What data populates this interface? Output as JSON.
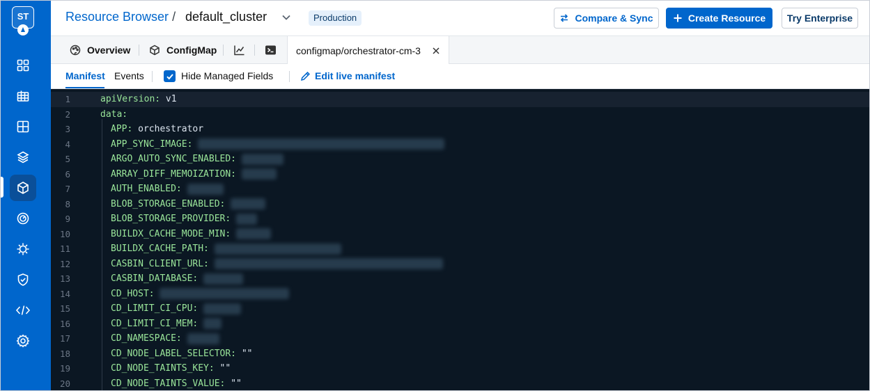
{
  "sidebar": {
    "logo_text": "ST",
    "items": [
      {
        "icon": "dashboard-grid-icon",
        "active": false
      },
      {
        "icon": "table-grid-icon",
        "active": false
      },
      {
        "icon": "apps-grid-icon",
        "active": false
      },
      {
        "icon": "stack-layers-icon",
        "active": false
      },
      {
        "icon": "cube-icon",
        "active": true
      },
      {
        "icon": "target-icon",
        "active": false
      },
      {
        "icon": "bug-gear-icon",
        "active": false
      },
      {
        "icon": "shield-check-icon",
        "active": false
      },
      {
        "icon": "code-icon",
        "active": false
      },
      {
        "icon": "gear-icon",
        "active": false
      }
    ]
  },
  "header": {
    "breadcrumb_link": "Resource Browser",
    "breadcrumb_sep": "/",
    "cluster": "default_cluster",
    "env_badge": "Production",
    "compare_label": "Compare & Sync",
    "create_label": "Create Resource",
    "enterprise_label": "Try Enterprise"
  },
  "tabs": {
    "overview": "Overview",
    "configmap": "ConfigMap",
    "active_tab": "configmap/orchestrator-cm-3"
  },
  "subbar": {
    "manifest": "Manifest",
    "events": "Events",
    "hide_managed": "Hide Managed Fields",
    "hide_managed_checked": true,
    "edit_live": "Edit live manifest"
  },
  "editor": {
    "lines": [
      {
        "n": "1",
        "key": "apiVersion:",
        "value": "v1",
        "indent": 0,
        "redacted": false
      },
      {
        "n": "2",
        "key": "data:",
        "value": "",
        "indent": 0,
        "redacted": false
      },
      {
        "n": "3",
        "key": "APP:",
        "value": "orchestrator",
        "indent": 1,
        "redacted": false
      },
      {
        "n": "4",
        "key": "APP_SYNC_IMAGE:",
        "value": "",
        "indent": 1,
        "redacted": true
      },
      {
        "n": "5",
        "key": "ARGO_AUTO_SYNC_ENABLED:",
        "value": "",
        "indent": 1,
        "redacted": true
      },
      {
        "n": "6",
        "key": "ARRAY_DIFF_MEMOIZATION:",
        "value": "",
        "indent": 1,
        "redacted": true
      },
      {
        "n": "7",
        "key": "AUTH_ENABLED:",
        "value": "",
        "indent": 1,
        "redacted": true
      },
      {
        "n": "8",
        "key": "BLOB_STORAGE_ENABLED:",
        "value": "",
        "indent": 1,
        "redacted": true
      },
      {
        "n": "9",
        "key": "BLOB_STORAGE_PROVIDER:",
        "value": "",
        "indent": 1,
        "redacted": true
      },
      {
        "n": "10",
        "key": "BUILDX_CACHE_MODE_MIN:",
        "value": "",
        "indent": 1,
        "redacted": true
      },
      {
        "n": "11",
        "key": "BUILDX_CACHE_PATH:",
        "value": "",
        "indent": 1,
        "redacted": true
      },
      {
        "n": "12",
        "key": "CASBIN_CLIENT_URL:",
        "value": "",
        "indent": 1,
        "redacted": true
      },
      {
        "n": "13",
        "key": "CASBIN_DATABASE:",
        "value": "",
        "indent": 1,
        "redacted": true
      },
      {
        "n": "14",
        "key": "CD_HOST:",
        "value": "",
        "indent": 1,
        "redacted": true
      },
      {
        "n": "15",
        "key": "CD_LIMIT_CI_CPU:",
        "value": "",
        "indent": 1,
        "redacted": true
      },
      {
        "n": "16",
        "key": "CD_LIMIT_CI_MEM:",
        "value": "",
        "indent": 1,
        "redacted": true
      },
      {
        "n": "17",
        "key": "CD_NAMESPACE:",
        "value": "",
        "indent": 1,
        "redacted": true
      },
      {
        "n": "18",
        "key": "CD_NODE_LABEL_SELECTOR:",
        "value": "\"\"",
        "indent": 1,
        "redacted": false
      },
      {
        "n": "19",
        "key": "CD_NODE_TAINTS_KEY:",
        "value": "\"\"",
        "indent": 1,
        "redacted": false
      },
      {
        "n": "20",
        "key": "CD_NODE_TAINTS_VALUE:",
        "value": "\"\"",
        "indent": 1,
        "redacted": false
      }
    ]
  }
}
